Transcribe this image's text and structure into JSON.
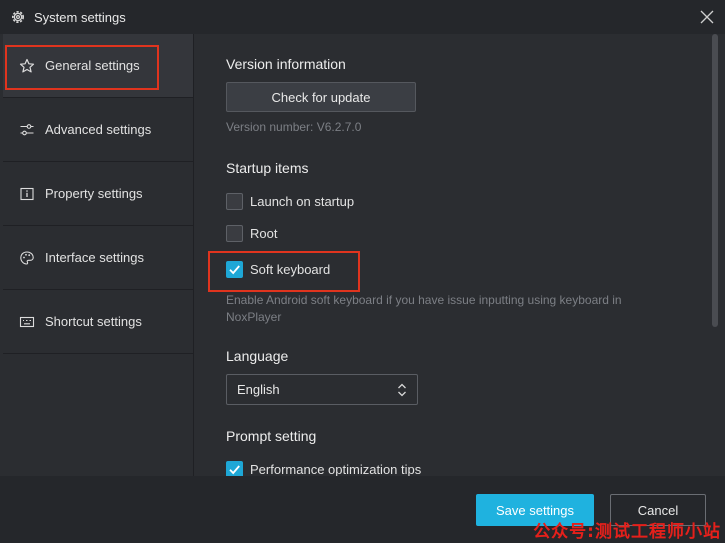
{
  "window": {
    "title": "System settings",
    "icons": {
      "title": "gear-icon",
      "close": "close-icon"
    }
  },
  "sidebar": {
    "items": [
      {
        "label": "General settings",
        "icon": "star-icon",
        "active": true
      },
      {
        "label": "Advanced settings",
        "icon": "sliders-icon",
        "active": false
      },
      {
        "label": "Property settings",
        "icon": "info-icon",
        "active": false
      },
      {
        "label": "Interface settings",
        "icon": "palette-icon",
        "active": false
      },
      {
        "label": "Shortcut settings",
        "icon": "keyboard-icon",
        "active": false
      }
    ]
  },
  "version": {
    "title": "Version information",
    "update_button": "Check for update",
    "number": "Version number: V6.2.7.0"
  },
  "startup": {
    "title": "Startup items",
    "items": [
      {
        "label": "Launch on startup",
        "checked": false
      },
      {
        "label": "Root",
        "checked": false
      },
      {
        "label": "Soft keyboard",
        "checked": true
      }
    ],
    "soft_keyboard_hint_line1": "Enable Android soft keyboard if you have issue inputting using keyboard in",
    "soft_keyboard_hint_line2": "NoxPlayer"
  },
  "language": {
    "title": "Language",
    "selected": "English"
  },
  "prompt": {
    "title": "Prompt setting",
    "items": [
      {
        "label": "Performance optimization tips",
        "checked": true
      }
    ]
  },
  "footer": {
    "save_label": "Save settings",
    "cancel_label": "Cancel"
  },
  "watermark": "公众号:测试工程师小站",
  "colors": {
    "accent": "#1fb2df",
    "highlight": "#e0341e",
    "background": "#2b2d31",
    "titlebar": "#25272b"
  }
}
